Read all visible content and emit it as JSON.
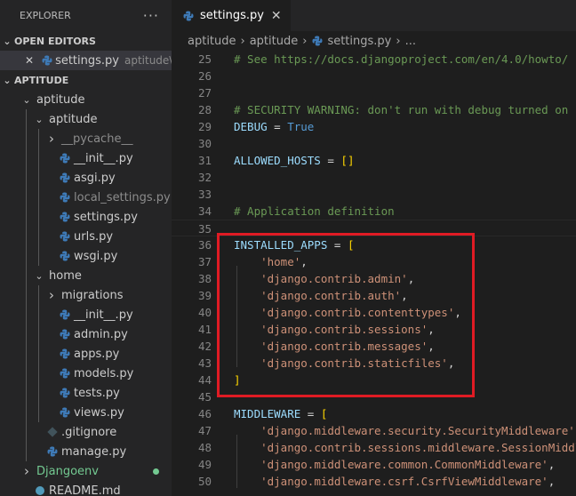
{
  "explorer": {
    "title": "EXPLORER",
    "more": "···",
    "open_editors_label": "OPEN EDITORS",
    "open_editor": {
      "name": "settings.py",
      "path": "aptitude\\..."
    },
    "project_label": "APTITUDE",
    "tree": [
      {
        "name": "aptitude",
        "kind": "folder-open",
        "depth": 1
      },
      {
        "name": "aptitude",
        "kind": "folder-open",
        "depth": 2
      },
      {
        "name": "__pycache__",
        "kind": "folder",
        "depth": 3,
        "style": "gray"
      },
      {
        "name": "__init__.py",
        "kind": "py",
        "depth": 3
      },
      {
        "name": "asgi.py",
        "kind": "py",
        "depth": 3
      },
      {
        "name": "local_settings.py",
        "kind": "py",
        "depth": 3,
        "style": "gray"
      },
      {
        "name": "settings.py",
        "kind": "py",
        "depth": 3
      },
      {
        "name": "urls.py",
        "kind": "py",
        "depth": 3
      },
      {
        "name": "wsgi.py",
        "kind": "py",
        "depth": 3
      },
      {
        "name": "home",
        "kind": "folder-open",
        "depth": 2
      },
      {
        "name": "migrations",
        "kind": "folder",
        "depth": 3
      },
      {
        "name": "__init__.py",
        "kind": "py",
        "depth": 3
      },
      {
        "name": "admin.py",
        "kind": "py",
        "depth": 3
      },
      {
        "name": "apps.py",
        "kind": "py",
        "depth": 3
      },
      {
        "name": "models.py",
        "kind": "py",
        "depth": 3
      },
      {
        "name": "tests.py",
        "kind": "py",
        "depth": 3
      },
      {
        "name": "views.py",
        "kind": "py",
        "depth": 3
      },
      {
        "name": ".gitignore",
        "kind": "git",
        "depth": 2
      },
      {
        "name": "manage.py",
        "kind": "py",
        "depth": 2
      },
      {
        "name": "Djangoenv",
        "kind": "folder",
        "depth": 1,
        "style": "green",
        "dot": true
      },
      {
        "name": "README.md",
        "kind": "md",
        "depth": 1
      }
    ]
  },
  "editor": {
    "tab": {
      "name": "settings.py",
      "close": "✕"
    },
    "breadcrumb": [
      "aptitude",
      "aptitude",
      "settings.py",
      "..."
    ],
    "lines": [
      {
        "n": "25",
        "tokens": [
          [
            "c-com",
            "# See https://docs.djangoproject.com/en/4.0/howto/"
          ]
        ]
      },
      {
        "n": "26",
        "tokens": []
      },
      {
        "n": "27",
        "tokens": []
      },
      {
        "n": "28",
        "tokens": [
          [
            "c-com",
            "# SECURITY WARNING: don't run with debug turned on"
          ]
        ]
      },
      {
        "n": "29",
        "tokens": [
          [
            "c-var",
            "DEBUG"
          ],
          [
            "c-op",
            " = "
          ],
          [
            "c-kw",
            "True"
          ]
        ]
      },
      {
        "n": "30",
        "tokens": []
      },
      {
        "n": "31",
        "tokens": [
          [
            "c-var",
            "ALLOWED_HOSTS"
          ],
          [
            "c-op",
            " = "
          ],
          [
            "c-br",
            "[]"
          ]
        ]
      },
      {
        "n": "32",
        "tokens": []
      },
      {
        "n": "33",
        "tokens": []
      },
      {
        "n": "34",
        "tokens": [
          [
            "c-com",
            "# Application definition"
          ]
        ]
      },
      {
        "n": "35",
        "tokens": [],
        "current": true
      },
      {
        "n": "36",
        "tokens": [
          [
            "c-var",
            "INSTALLED_APPS"
          ],
          [
            "c-op",
            " = "
          ],
          [
            "c-br",
            "["
          ]
        ]
      },
      {
        "n": "37",
        "tokens": [
          [
            "c-op",
            "    "
          ],
          [
            "c-str",
            "'home'"
          ],
          [
            "c-op",
            ","
          ]
        ],
        "modified": true
      },
      {
        "n": "38",
        "tokens": [
          [
            "c-op",
            "    "
          ],
          [
            "c-str",
            "'django.contrib.admin'"
          ],
          [
            "c-op",
            ","
          ]
        ]
      },
      {
        "n": "39",
        "tokens": [
          [
            "c-op",
            "    "
          ],
          [
            "c-str",
            "'django.contrib.auth'"
          ],
          [
            "c-op",
            ","
          ]
        ]
      },
      {
        "n": "40",
        "tokens": [
          [
            "c-op",
            "    "
          ],
          [
            "c-str",
            "'django.contrib.contenttypes'"
          ],
          [
            "c-op",
            ","
          ]
        ]
      },
      {
        "n": "41",
        "tokens": [
          [
            "c-op",
            "    "
          ],
          [
            "c-str",
            "'django.contrib.sessions'"
          ],
          [
            "c-op",
            ","
          ]
        ]
      },
      {
        "n": "42",
        "tokens": [
          [
            "c-op",
            "    "
          ],
          [
            "c-str",
            "'django.contrib.messages'"
          ],
          [
            "c-op",
            ","
          ]
        ]
      },
      {
        "n": "43",
        "tokens": [
          [
            "c-op",
            "    "
          ],
          [
            "c-str",
            "'django.contrib.staticfiles'"
          ],
          [
            "c-op",
            ","
          ]
        ]
      },
      {
        "n": "44",
        "tokens": [
          [
            "c-br",
            "]"
          ]
        ]
      },
      {
        "n": "45",
        "tokens": []
      },
      {
        "n": "46",
        "tokens": [
          [
            "c-var",
            "MIDDLEWARE"
          ],
          [
            "c-op",
            " = "
          ],
          [
            "c-br",
            "["
          ]
        ]
      },
      {
        "n": "47",
        "tokens": [
          [
            "c-op",
            "    "
          ],
          [
            "c-str",
            "'django.middleware.security.SecurityMiddleware'"
          ],
          [
            "c-op",
            ","
          ]
        ]
      },
      {
        "n": "48",
        "tokens": [
          [
            "c-op",
            "    "
          ],
          [
            "c-str",
            "'django.contrib.sessions.middleware.SessionMiddleware'"
          ],
          [
            "c-op",
            ","
          ]
        ]
      },
      {
        "n": "49",
        "tokens": [
          [
            "c-op",
            "    "
          ],
          [
            "c-str",
            "'django.middleware.common.CommonMiddleware'"
          ],
          [
            "c-op",
            ","
          ]
        ]
      },
      {
        "n": "50",
        "tokens": [
          [
            "c-op",
            "    "
          ],
          [
            "c-str",
            "'django.middleware.csrf.CsrfViewMiddleware'"
          ],
          [
            "c-op",
            ","
          ]
        ]
      }
    ]
  },
  "colors": {
    "highlight": "#e01b24",
    "python_icon": "#3e7ab7",
    "git_icon": "#41535b"
  }
}
